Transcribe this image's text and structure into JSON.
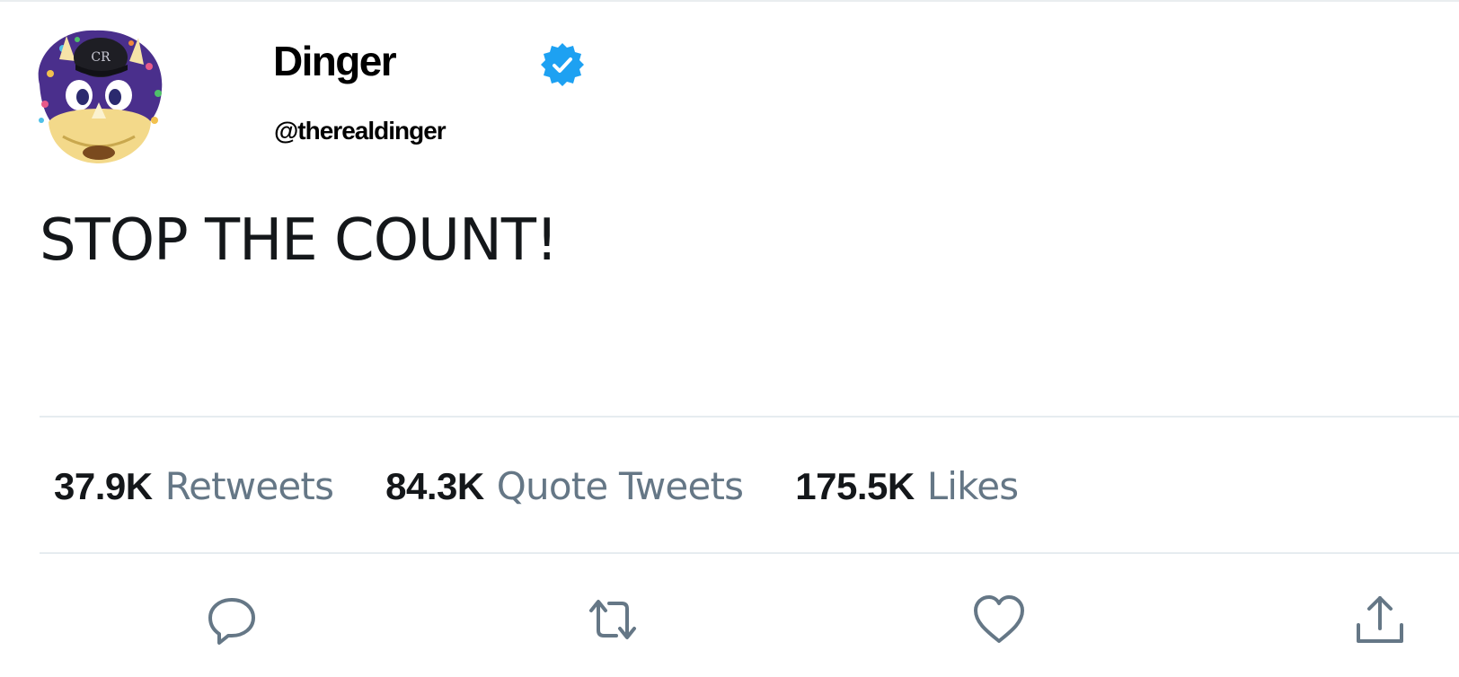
{
  "tweet": {
    "display_name": "Dinger",
    "handle": "@therealdinger",
    "verified": true,
    "text": "STOP THE COUNT!"
  },
  "stats": {
    "retweets_count": "37.9K",
    "retweets_label": "Retweets",
    "quote_tweets_count": "84.3K",
    "quote_tweets_label": "Quote Tweets",
    "likes_count": "175.5K",
    "likes_label": "Likes"
  },
  "actions": {
    "reply_icon": "speech-bubble-icon",
    "retweet_icon": "retweet-arrows-icon",
    "like_icon": "heart-icon",
    "share_icon": "share-upload-icon"
  },
  "colors": {
    "verified_blue": "#1da1f2",
    "muted_text": "#657786",
    "primary_text": "#14171a",
    "divider": "#e6ecf0",
    "icon_gray": "#657786"
  }
}
